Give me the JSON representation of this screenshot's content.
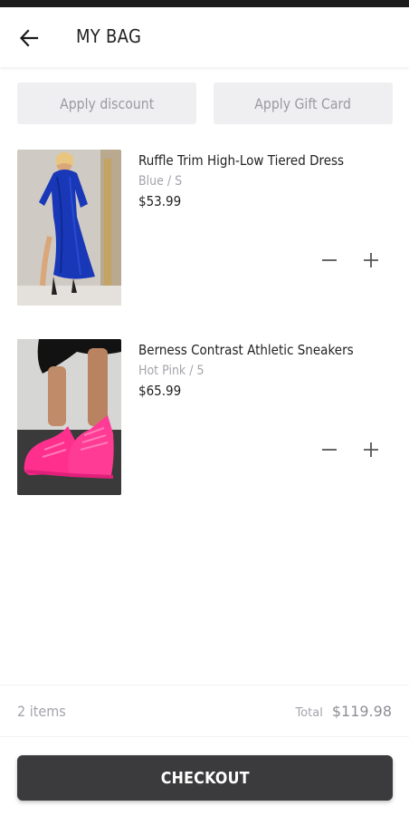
{
  "header": {
    "title": "MY BAG",
    "back_icon": "arrow-left-icon"
  },
  "promo": {
    "discount_label": "Apply discount",
    "gift_card_label": "Apply Gift Card"
  },
  "items": [
    {
      "name": "Ruffle Trim High-Low Tiered Dress",
      "variant": "Blue / S",
      "price": "$53.99",
      "image": "blue-dress-photo",
      "minus_icon": "minus-icon",
      "plus_icon": "plus-icon"
    },
    {
      "name": "Berness Contrast Athletic Sneakers",
      "variant": "Hot Pink / 5",
      "price": "$65.99",
      "image": "pink-sneakers-photo",
      "minus_icon": "minus-icon",
      "plus_icon": "plus-icon"
    }
  ],
  "summary": {
    "count_label": "2 items",
    "total_label": "Total",
    "total_value": "$119.98"
  },
  "checkout": {
    "label": "CHECKOUT"
  },
  "colors": {
    "checkout_bg": "#3b3b3d",
    "promo_bg": "#efeff1",
    "muted_text": "#a3a4ab"
  }
}
